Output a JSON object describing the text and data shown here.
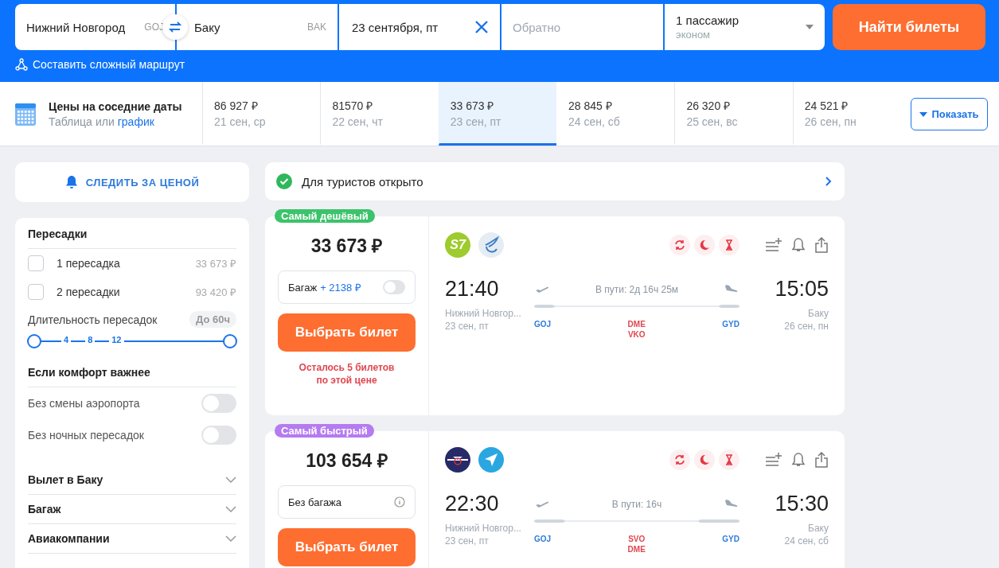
{
  "search": {
    "origin": {
      "city": "Нижний Новгород",
      "code": "GOJ"
    },
    "destination": {
      "city": "Баку",
      "code": "BAK"
    },
    "date": "23 сентября, пт",
    "return_placeholder": "Обратно",
    "passengers": {
      "count": "1 пассажир",
      "class": "эконом"
    },
    "button": "Найти билеты",
    "complex_route": "Составить сложный маршрут"
  },
  "nearby_dates": {
    "title": "Цены на соседние даты",
    "table_link": "Таблица",
    "or": "или",
    "chart_link": "график",
    "show_button": "Показать",
    "dates": [
      {
        "price": "86 927 ₽",
        "date": "21 сен, ср",
        "selected": false
      },
      {
        "price": "81570 ₽",
        "date": "22 сен, чт",
        "selected": false
      },
      {
        "price": "33 673 ₽",
        "date": "23 сен, пт",
        "selected": true
      },
      {
        "price": "28 845 ₽",
        "date": "24 сен, сб",
        "selected": false
      },
      {
        "price": "26 320 ₽",
        "date": "25 сен, вс",
        "selected": false
      },
      {
        "price": "24 521 ₽",
        "date": "26 сен, пн",
        "selected": false
      }
    ]
  },
  "price_alert": "СЛЕДИТЬ ЗА ЦЕНОЙ",
  "filters": {
    "stops_title": "Пересадки",
    "stops": [
      {
        "label": "1 пересадка",
        "price": "33 673 ₽",
        "checked": false
      },
      {
        "label": "2 пересадки",
        "price": "93 420 ₽",
        "checked": false
      }
    ],
    "duration": {
      "label": "Длительность пересадок",
      "badge": "До 60ч",
      "ticks": [
        "4",
        "8",
        "12"
      ],
      "handles": [
        {
          "level": 0
        },
        {
          "level": 1
        }
      ]
    },
    "comfort_title": "Если комфорт важнее",
    "toggles": [
      {
        "label": "Без смены аэропорта",
        "on": false
      },
      {
        "label": "Без ночных пересадок",
        "on": false
      }
    ],
    "sections": [
      {
        "label": "Вылет в Баку",
        "expanded": false
      },
      {
        "label": "Багаж",
        "expanded": false
      },
      {
        "label": "Авиакомпании",
        "expanded": false
      }
    ]
  },
  "notice": {
    "text": "Для туристов открыто",
    "ok": true
  },
  "tickets": [
    {
      "badge": "Самый дешёвый",
      "kind": "cheapest",
      "price": "33 673 ₽",
      "baggage": {
        "kind": "toggle",
        "label": "Багаж",
        "extra": "+ 2138 ₽",
        "on": false
      },
      "button": "Выбрать билет",
      "warning": "Осталось 5 билетов по этой цене",
      "airlines": [
        {
          "kind": "lettered",
          "text": "S7"
        },
        {
          "kind": "wing"
        }
      ],
      "depart": {
        "time": "21:40",
        "city": "Нижний Новгор...",
        "date": "23 сен, пт",
        "code": "GOJ"
      },
      "arrive": {
        "time": "15:05",
        "city": "Баку",
        "date": "26 сен, пн",
        "code": "GYD"
      },
      "duration": "В пути: 2д 16ч 25м",
      "transfers": [
        "DME",
        "VKO"
      ]
    },
    {
      "badge": "Самый быстрый",
      "kind": "fastest",
      "price": "103 654 ₽",
      "baggage": {
        "kind": "info",
        "label": "Без багажа"
      },
      "button": "Выбрать билет",
      "airlines": [
        {
          "kind": "emblem"
        },
        {
          "kind": "plane"
        }
      ],
      "depart": {
        "time": "22:30",
        "city": "Нижний Новгор...",
        "date": "23 сен, пт",
        "code": "GOJ"
      },
      "arrive": {
        "time": "15:30",
        "city": "Баку",
        "date": "24 сен, сб",
        "code": "GYD"
      },
      "duration": "В пути: 16ч",
      "transfers": [
        "SVO",
        "DME"
      ]
    }
  ]
}
